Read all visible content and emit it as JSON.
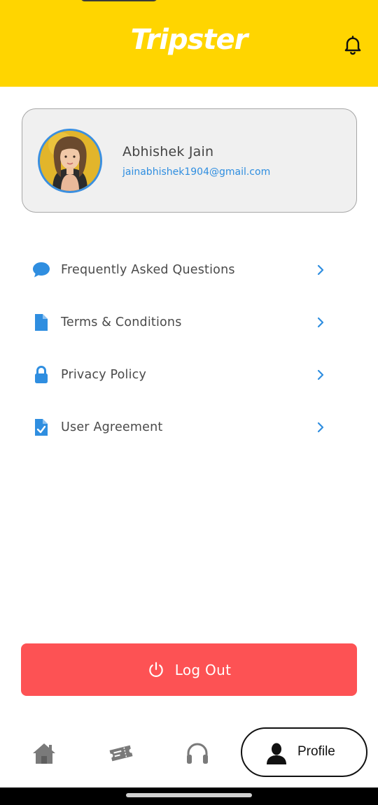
{
  "header": {
    "logo_text": "Tripster",
    "bell_icon": "bell-icon"
  },
  "profile": {
    "name": "Abhishek Jain",
    "email": "jainabhishek1904@gmail.com",
    "avatar_icon": "avatar"
  },
  "menu": {
    "items": [
      {
        "label": "Frequently Asked Questions",
        "icon": "chat-bubble-icon"
      },
      {
        "label": "Terms & Conditions",
        "icon": "document-icon"
      },
      {
        "label": "Privacy Policy",
        "icon": "lock-icon"
      },
      {
        "label": "User Agreement",
        "icon": "document-check-icon"
      }
    ]
  },
  "logout": {
    "label": "Log Out",
    "icon": "power-icon"
  },
  "bottom_nav": {
    "items": [
      {
        "icon": "home-icon"
      },
      {
        "icon": "ticket-icon"
      },
      {
        "icon": "headphones-icon"
      }
    ],
    "active": {
      "label": "Profile",
      "icon": "person-icon"
    }
  },
  "colors": {
    "brand_yellow": "#FFD500",
    "accent_blue": "#2f8ee0",
    "logout_red": "#fd5254",
    "nav_gray": "#7a7a7a"
  }
}
